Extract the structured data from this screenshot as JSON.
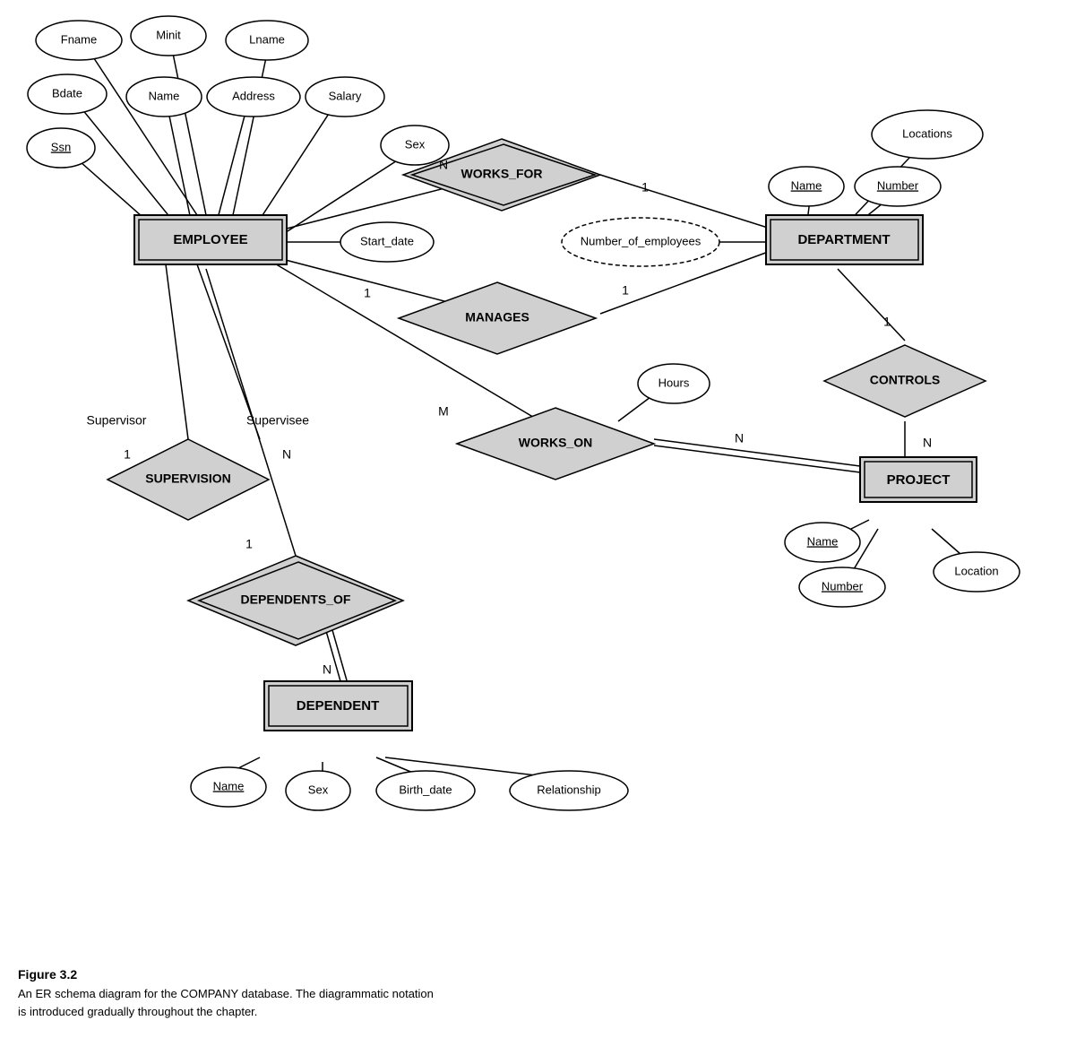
{
  "caption": {
    "title": "Figure 3.2",
    "line1": "An ER schema diagram for the COMPANY database. The diagrammatic notation",
    "line2": "is introduced gradually throughout the chapter."
  },
  "entities": {
    "employee": "EMPLOYEE",
    "department": "DEPARTMENT",
    "project": "PROJECT",
    "dependent": "DEPENDENT"
  },
  "relationships": {
    "works_for": "WORKS_FOR",
    "manages": "MANAGES",
    "works_on": "WORKS_ON",
    "controls": "CONTROLS",
    "supervision": "SUPERVISION",
    "dependents_of": "DEPENDENTS_OF"
  },
  "attributes": {
    "fname": "Fname",
    "minit": "Minit",
    "lname": "Lname",
    "bdate": "Bdate",
    "name_emp": "Name",
    "address": "Address",
    "salary": "Salary",
    "ssn": "Ssn",
    "sex_emp": "Sex",
    "start_date": "Start_date",
    "number_of_employees": "Number_of_employees",
    "locations": "Locations",
    "name_dept": "Name",
    "number_dept": "Number",
    "hours": "Hours",
    "name_proj": "Name",
    "number_proj": "Number",
    "location_proj": "Location",
    "name_dep": "Name",
    "sex_dep": "Sex",
    "birth_date": "Birth_date",
    "relationship": "Relationship"
  },
  "cardinalities": {
    "n1": "N",
    "one1": "1",
    "one2": "1",
    "one3": "1",
    "m1": "M",
    "n2": "N",
    "n3": "N",
    "one4": "1",
    "supervisor": "Supervisor",
    "supervisee": "Supervisee",
    "one5": "1",
    "n4": "N",
    "n5": "N"
  }
}
